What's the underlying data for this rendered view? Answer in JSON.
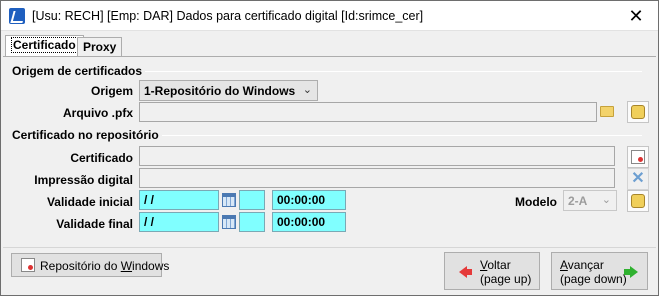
{
  "window": {
    "title": "[Usu: RECH] [Emp: DAR] Dados para certificado digital [Id:srimce_cer]",
    "close_glyph": "✕"
  },
  "tabs": [
    {
      "label": "Certificado",
      "active": true
    },
    {
      "label": "Proxy",
      "active": false
    }
  ],
  "origem_section": {
    "title": "Origem de certificados",
    "origem_label": "Origem",
    "origem_value": "1-Repositório do Windows",
    "arquivo_label": "Arquivo .pfx",
    "arquivo_value": ""
  },
  "repo_section": {
    "title": "Certificado no repositório",
    "certificado_label": "Certificado",
    "certificado_value": "",
    "impressao_label": "Impressão digital",
    "impressao_value": "",
    "validade_inicial_label": "Validade inicial",
    "validade_inicial_date": " /  /",
    "validade_inicial_day": "",
    "validade_inicial_time": "00:00:00",
    "validade_final_label": "Validade final",
    "validade_final_date": " /  /",
    "validade_final_day": "",
    "validade_final_time": "00:00:00",
    "modelo_label": "Modelo",
    "modelo_value": "2-A"
  },
  "footer": {
    "repo_button_pre": "Repositório do ",
    "repo_button_underline": "W",
    "repo_button_post": "indows",
    "voltar_line1": "Voltar",
    "voltar_line2": "(page up)",
    "avancar_line1": "Avançar",
    "avancar_line2": "(page down)"
  },
  "icons": {
    "app": "app-icon",
    "folder": "folder-icon",
    "lock": "lock-icon",
    "certificate": "certificate-icon",
    "clear": "clear-x-icon",
    "calendar": "calendar-icon",
    "arrow_back": "arrow-left-icon",
    "arrow_next": "arrow-right-icon"
  },
  "colors": {
    "cyan_field": "#80ffff",
    "back_arrow": "#e53a3a",
    "next_arrow": "#2fb12f"
  }
}
